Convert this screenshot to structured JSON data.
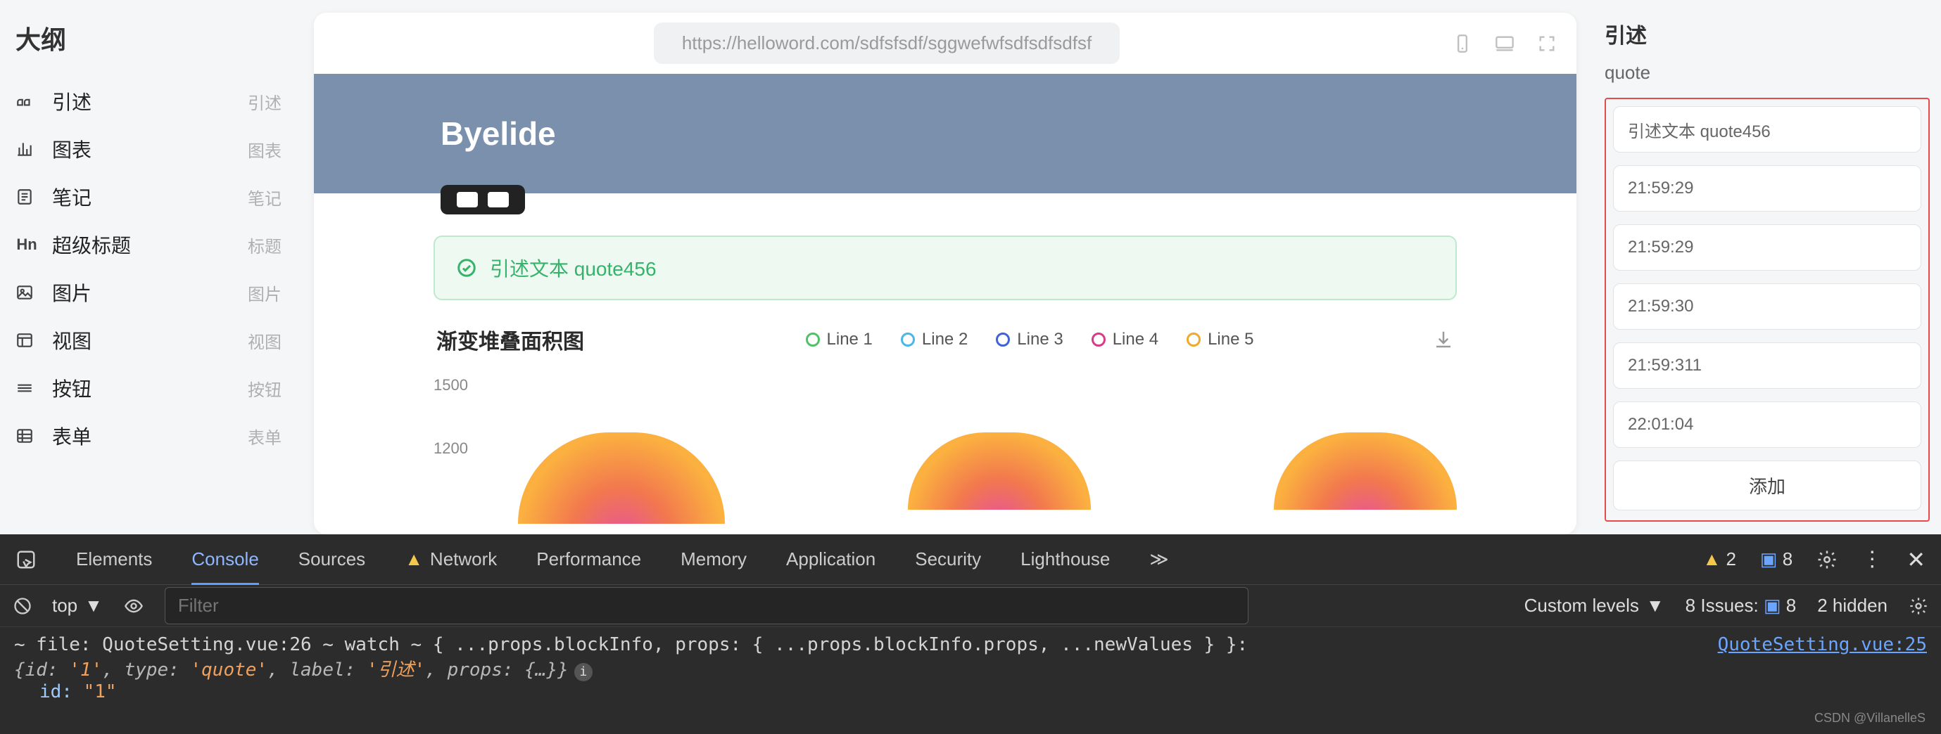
{
  "outline": {
    "title": "大纲",
    "items": [
      {
        "icon": "quote-icon",
        "label": "引述",
        "tag": "引述"
      },
      {
        "icon": "chart-icon",
        "label": "图表",
        "tag": "图表"
      },
      {
        "icon": "note-icon",
        "label": "笔记",
        "tag": "笔记"
      },
      {
        "icon": "heading-icon",
        "label": "超级标题",
        "tag": "标题"
      },
      {
        "icon": "image-icon",
        "label": "图片",
        "tag": "图片"
      },
      {
        "icon": "view-icon",
        "label": "视图",
        "tag": "视图"
      },
      {
        "icon": "button-icon",
        "label": "按钮",
        "tag": "按钮"
      },
      {
        "icon": "form-icon",
        "label": "表单",
        "tag": "表单"
      }
    ]
  },
  "preview": {
    "url": "https://helloword.com/sdfsfsdf/sggwefwfsdfsdfsdfsf",
    "hero_title": "Byelide",
    "quote_text": "引述文本 quote456"
  },
  "chart_data": {
    "type": "area",
    "title": "渐变堆叠面积图",
    "series": [
      {
        "name": "Line 1",
        "color": "#4fc267"
      },
      {
        "name": "Line 2",
        "color": "#4bb6e8"
      },
      {
        "name": "Line 3",
        "color": "#4062d8"
      },
      {
        "name": "Line 4",
        "color": "#d83a8a"
      },
      {
        "name": "Line 5",
        "color": "#f0a92e"
      }
    ],
    "y_ticks": [
      1500,
      1200
    ],
    "ylim": [
      0,
      1500
    ]
  },
  "right": {
    "title": "引述",
    "subtitle": "quote",
    "fields": [
      "引述文本 quote456",
      "21:59:29",
      "21:59:29",
      "21:59:30",
      "21:59:311",
      "22:01:04"
    ],
    "add_btn": "添加"
  },
  "devtools": {
    "tabs": [
      "Elements",
      "Console",
      "Sources",
      "Network",
      "Performance",
      "Memory",
      "Application",
      "Security",
      "Lighthouse"
    ],
    "active_tab": "Console",
    "warn_count": "2",
    "info_count": "8",
    "ctx": "top",
    "filter_placeholder": "Filter",
    "levels": "Custom levels",
    "issues_label": "8 Issues:",
    "issues_count": "8",
    "hidden": "2 hidden",
    "log_msg": "~ file: QuoteSetting.vue:26 ~ watch ~ { ...props.blockInfo, props: { ...props.blockInfo.props, ...newValues } }:",
    "log_src": "QuoteSetting.vue:25",
    "obj_preview": {
      "id": "'1'",
      "type": "'quote'",
      "label": "'引述'",
      "props": "{…}"
    },
    "expanded_key": "id:",
    "expanded_val": "\"1\""
  },
  "watermark": "CSDN @VillanelleS"
}
